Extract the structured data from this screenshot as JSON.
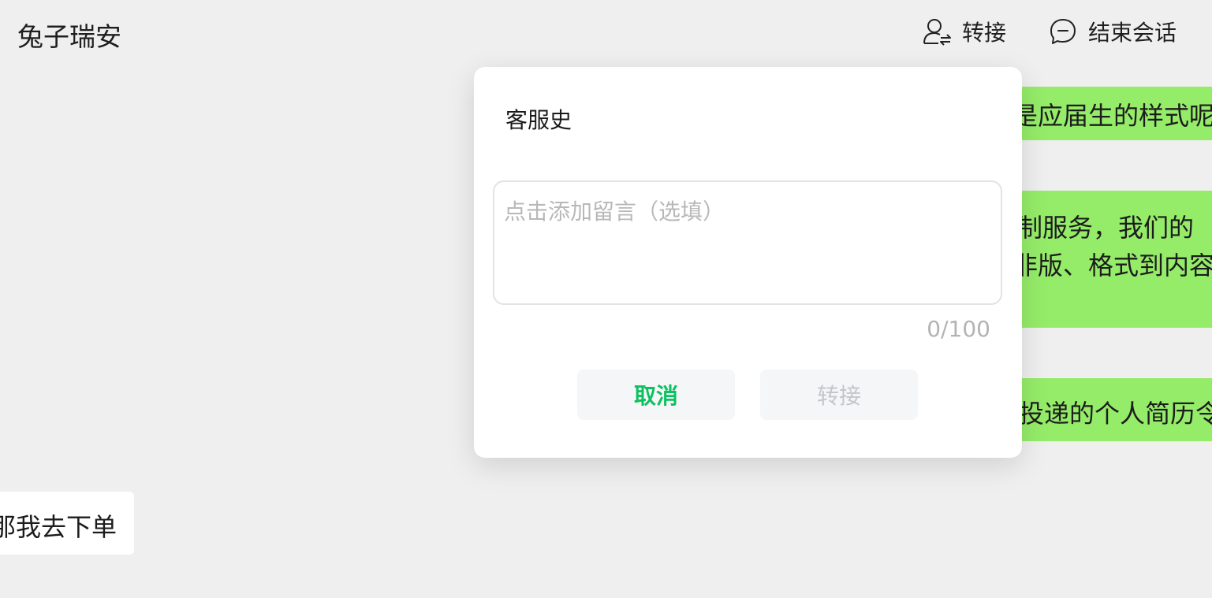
{
  "header": {
    "title": "兔子瑞安",
    "actions": {
      "transfer": {
        "label": "转接",
        "icon": "user-transfer-icon"
      },
      "end": {
        "label": "结束会话",
        "icon": "chat-bubble-icon"
      }
    }
  },
  "messages": [
    {
      "side": "right",
      "text": "是应届生的样式呢"
    },
    {
      "side": "right",
      "lines": [
        "制服务，我们的",
        "非版、格式到内容"
      ]
    },
    {
      "side": "right",
      "text": "投递的个人简历令"
    },
    {
      "side": "left",
      "text": "那我去下单"
    }
  ],
  "modal": {
    "title": "客服史",
    "message_placeholder": "点击添加留言（选填）",
    "message_value": "",
    "counter": "0/100",
    "cancel_label": "取消",
    "confirm_label": "转接"
  },
  "colors": {
    "accent": "#0bc160",
    "bubble_green": "#95ec69",
    "background": "#efefef",
    "disabled_text": "#c3c6cb"
  }
}
